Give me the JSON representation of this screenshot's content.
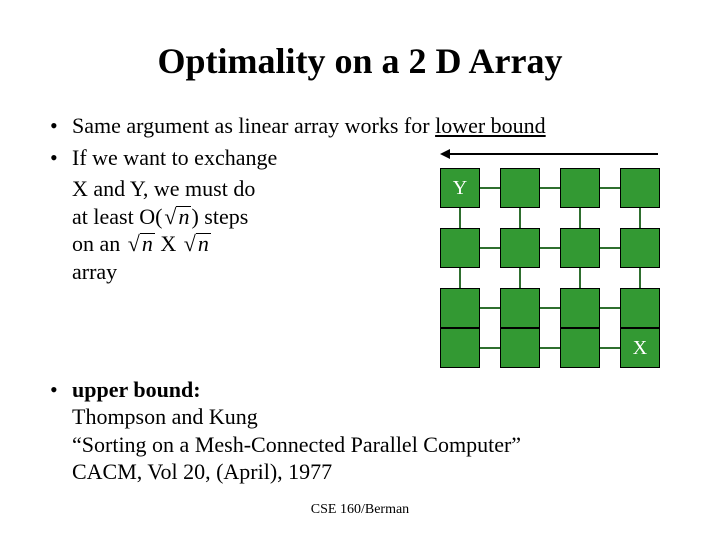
{
  "title": "Optimality on a 2 D Array",
  "bullets": {
    "b1": {
      "text_a": "Same argument as linear array works for ",
      "text_b": "lower bound"
    },
    "b2": {
      "text": "If we want to exchange"
    },
    "b2_lines": {
      "l1": "X and Y, we must do",
      "l2_a": "at least O(",
      "l2_b": ") steps",
      "l3_a": "on an ",
      "l3_b": "X",
      "l4": "array"
    },
    "b3": {
      "label": "upper bound:",
      "l1": "Thompson and Kung",
      "l2": "“Sorting on a Mesh-Connected Parallel Computer”",
      "l3": "CACM, Vol 20, (April), 1977"
    }
  },
  "math": {
    "sqrt_arg": "n"
  },
  "diagram": {
    "labelY": "Y",
    "labelX": "X"
  },
  "footer": "CSE 160/Berman"
}
